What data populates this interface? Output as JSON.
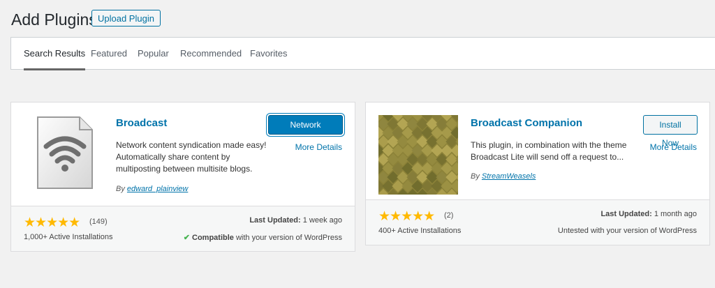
{
  "header": {
    "title": "Add Plugins",
    "upload_label": "Upload Plugin"
  },
  "tabs": [
    {
      "label": "Search Results",
      "active": true
    },
    {
      "label": "Featured"
    },
    {
      "label": "Popular"
    },
    {
      "label": "Recommended"
    },
    {
      "label": "Favorites"
    }
  ],
  "plugins": [
    {
      "name": "Broadcast",
      "action_label": "Network Activate",
      "more_details": "More Details",
      "description": "Network content syndication made easy! Automatically share content by multiposting between multisite blogs.",
      "by_label": "By",
      "author": "edward_plainview",
      "stars": "★★★★★",
      "rating_count": "(149)",
      "installs": "1,000+ Active Installations",
      "last_updated_label": "Last Updated:",
      "last_updated_value": "1 week ago",
      "compat_check": "✔",
      "compat_strong": "Compatible",
      "compat_rest": "with your version of WordPress",
      "icon": "wifi-file-icon"
    },
    {
      "name": "Broadcast Companion",
      "action_label": "Install Now",
      "more_details": "More Details",
      "description": "This plugin, in combination with the theme Broadcast Lite will send off a request to...",
      "by_label": "By",
      "author": "StreamWeasels",
      "stars": "★★★★★",
      "rating_count": "(2)",
      "installs": "400+ Active Installations",
      "last_updated_label": "Last Updated:",
      "last_updated_value": "1 month ago",
      "compat_text": "Untested with your version of WordPress",
      "icon": "olive-mosaic-icon"
    }
  ]
}
